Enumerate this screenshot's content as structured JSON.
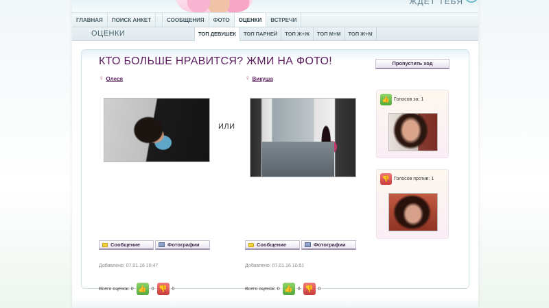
{
  "header": {
    "link_text": "ЖДЁТ ТЕБЯ"
  },
  "main_nav": {
    "items": [
      {
        "label": "ГЛАВНАЯ"
      },
      {
        "label": "ПОИСК АНКЕТ"
      },
      {
        "label": "СООБЩЕНИЯ"
      },
      {
        "label": "ФОТО"
      },
      {
        "label": "ОЦЕНКИ",
        "active": true
      },
      {
        "label": "ВСТРЕЧИ"
      }
    ]
  },
  "sub_nav": {
    "title": "ОЦЕНКИ",
    "tabs": [
      {
        "label": "ТОП ДЕВУШЕК",
        "active": true
      },
      {
        "label": "ТОП ПАРНЕЙ"
      },
      {
        "label": "ТОП Ж+Ж"
      },
      {
        "label": "ТОП М+М"
      },
      {
        "label": "ТОП Ж+М"
      }
    ]
  },
  "content": {
    "question": "КТО БОЛЬШЕ НРАВИТСЯ? ЖМИ НА ФОТО!",
    "skip_label": "Пропустить ход",
    "or_text": "ИЛИ",
    "profiles": [
      {
        "name": "Олеся",
        "message_label": "Сообщение",
        "photos_label": "Фотографии",
        "added": "Добавлено: 07.01.16 10:47",
        "total_label": "Всего оценок: 0",
        "up_count": "0",
        "down_count": "0"
      },
      {
        "name": "Викуша",
        "message_label": "Сообщение",
        "photos_label": "Фотографии",
        "added": "Добавлено: 07.01.16 10:51",
        "total_label": "Всего оценок: 0",
        "up_count": "0",
        "down_count": "0"
      }
    ],
    "votes_for": "Голосов за: 1",
    "votes_against": "Голосов против: 1"
  },
  "icons": {
    "female": "female-symbol-icon",
    "thumb_up": "thumb-up-icon",
    "thumb_down": "thumb-down-icon",
    "message": "envelope-icon",
    "photos": "photo-album-icon"
  },
  "colors": {
    "title": "#5b1d5e",
    "thumb_up": "#55a93a",
    "thumb_down": "#c93a3a"
  }
}
